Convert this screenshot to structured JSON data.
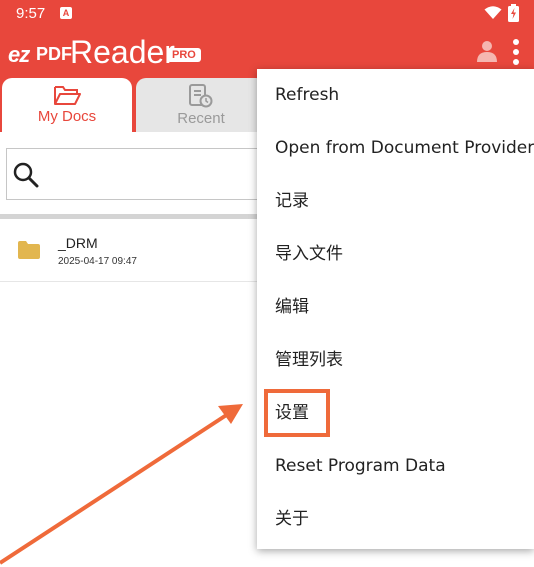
{
  "status_bar": {
    "time": "9:57",
    "notification_badge": "A"
  },
  "app_bar": {
    "logo_ez": "ez",
    "logo_pdf": "PDF",
    "logo_reader": "Reader",
    "logo_pro": "PRO"
  },
  "tabs": [
    {
      "label": "My Docs",
      "active": true
    },
    {
      "label": "Recent",
      "active": false
    }
  ],
  "search": {
    "placeholder": ""
  },
  "files": [
    {
      "name": "_DRM",
      "date": "2025-04-17 09:47"
    }
  ],
  "menu": {
    "items": [
      {
        "label": "Refresh"
      },
      {
        "label": "Open from Document Provider"
      },
      {
        "label": "记录"
      },
      {
        "label": "导入文件"
      },
      {
        "label": "编辑"
      },
      {
        "label": "管理列表"
      },
      {
        "label": "设置"
      },
      {
        "label": "Reset Program Data"
      },
      {
        "label": "关于"
      }
    ]
  },
  "colors": {
    "accent": "#e8473c",
    "highlight": "#ef6a3a",
    "folder": "#e2b64f"
  }
}
